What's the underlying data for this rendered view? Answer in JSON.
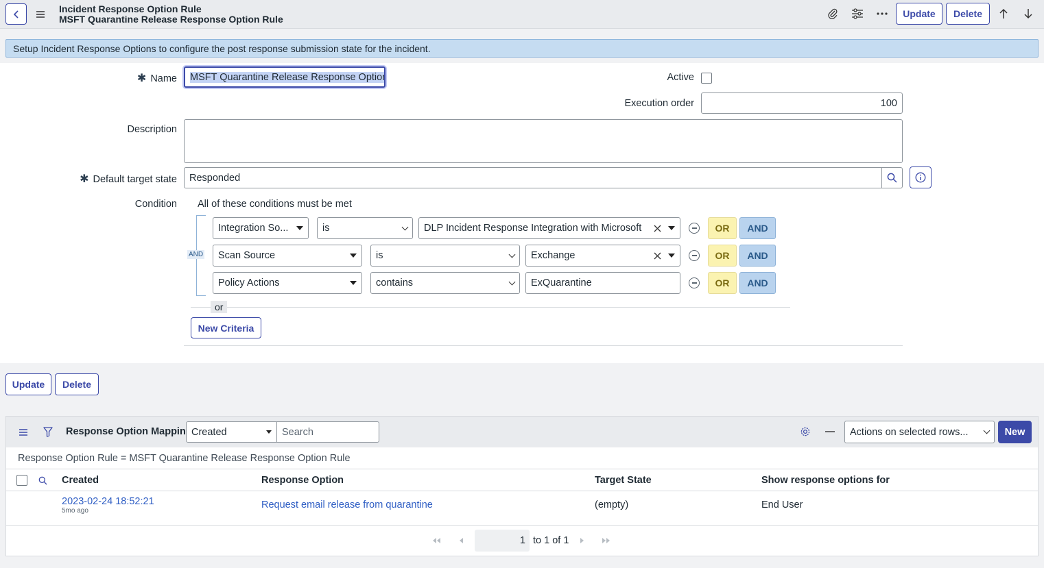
{
  "header": {
    "title_line1": "Incident Response Option Rule",
    "title_line2": "MSFT Quarantine Release Response Option Rule",
    "update_label": "Update",
    "delete_label": "Delete"
  },
  "banner": {
    "text": "Setup Incident Response Options to configure the post response submission state for the incident."
  },
  "form": {
    "name_label": "Name",
    "name_value": "MSFT Quarantine Release Response Option Rule",
    "active_label": "Active",
    "active_checked": false,
    "execution_order_label": "Execution order",
    "execution_order_value": "100",
    "description_label": "Description",
    "description_value": "",
    "default_target_state_label": "Default target state",
    "default_target_state_value": "Responded",
    "condition_label": "Condition",
    "condition_heading": "All of these conditions must be met",
    "and_tag": "AND",
    "conditions": [
      {
        "field": "Integration So...",
        "operator": "is",
        "value": "DLP Incident Response Integration with Microsoft"
      },
      {
        "field": "Scan Source",
        "operator": "is",
        "value": "Exchange"
      },
      {
        "field": "Policy Actions",
        "operator": "contains",
        "value": "ExQuarantine"
      }
    ],
    "or_label": "OR",
    "and_label": "AND",
    "or_separator": "or",
    "new_criteria_label": "New Criteria"
  },
  "bottom_buttons": {
    "update_label": "Update",
    "delete_label": "Delete"
  },
  "related_list": {
    "title": "Response Option Mappings",
    "search_field": "Created",
    "search_placeholder": "Search",
    "actions_select": "Actions on selected rows...",
    "new_label": "New",
    "breadcrumb": "Response Option Rule = MSFT Quarantine Release Response Option Rule",
    "columns": [
      "Created",
      "Response Option",
      "Target State",
      "Show response options for"
    ],
    "rows": [
      {
        "created": "2023-02-24 18:52:21",
        "created_relative": "5mo ago",
        "response_option": "Request email release from quarantine",
        "target_state": "(empty)",
        "show_for": "End User"
      }
    ],
    "pagination": {
      "current_page": "1",
      "range_text": "to 1 of 1"
    }
  }
}
